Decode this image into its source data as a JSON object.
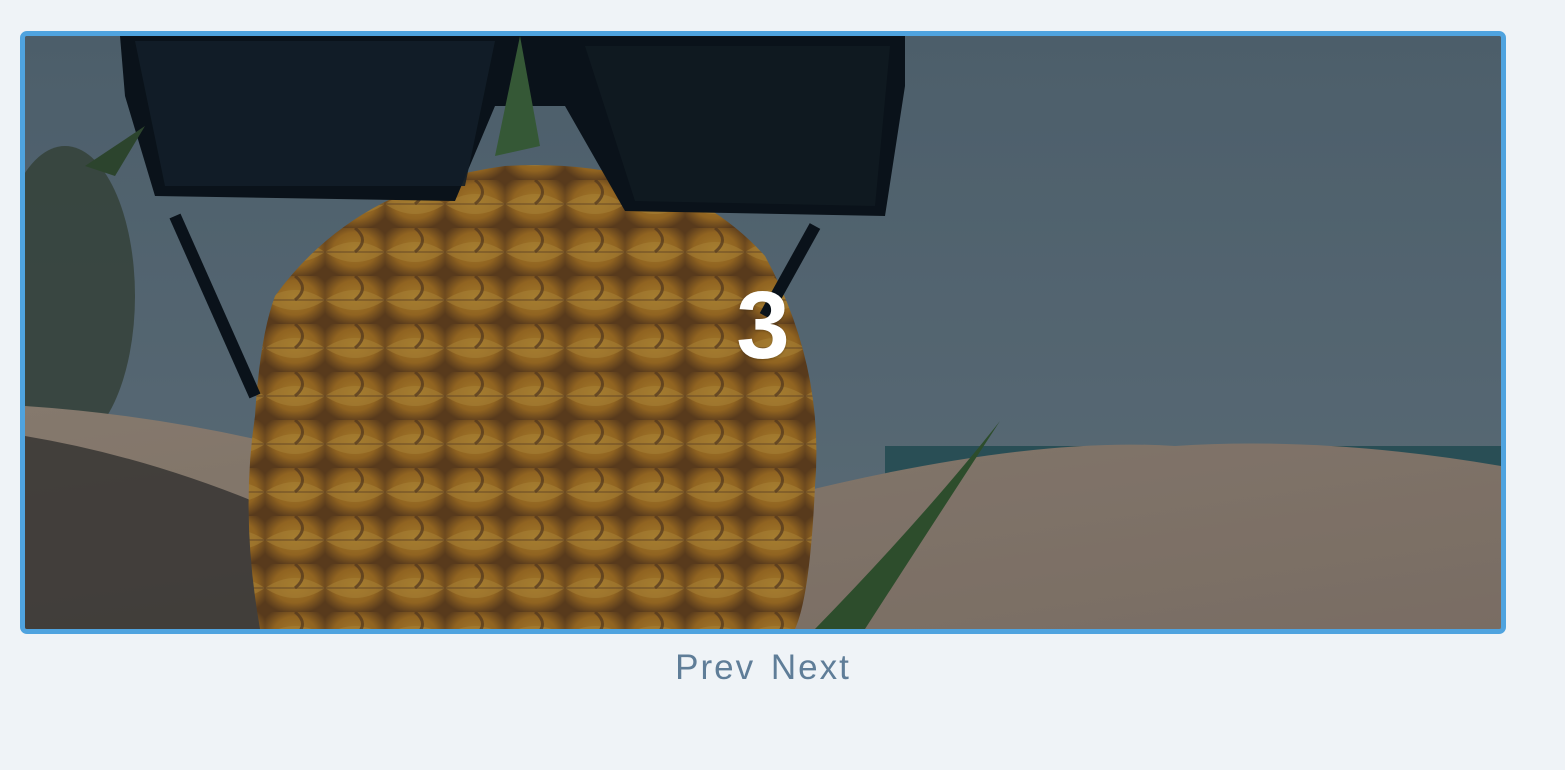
{
  "carousel": {
    "current_slide": "3",
    "border_color": "#4fa3df",
    "image": "pineapple-with-sunglasses-on-beach"
  },
  "controls": {
    "prev_label": "Prev",
    "next_label": "Next",
    "color": "#5f7d98"
  }
}
